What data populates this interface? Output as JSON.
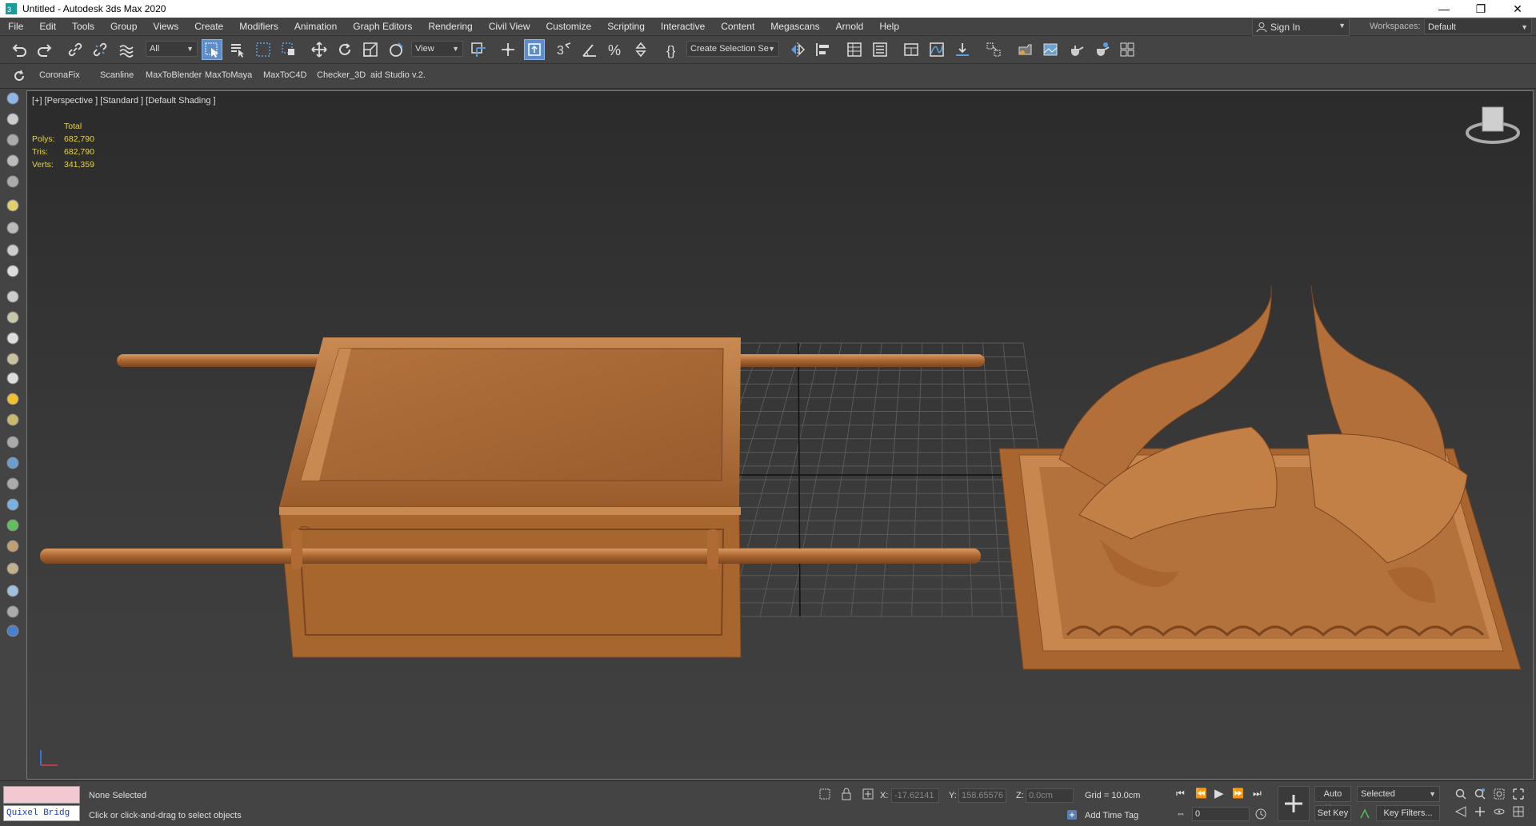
{
  "window": {
    "title": "Untitled - Autodesk 3ds Max 2020"
  },
  "menu": [
    "File",
    "Edit",
    "Tools",
    "Group",
    "Views",
    "Create",
    "Modifiers",
    "Animation",
    "Graph Editors",
    "Rendering",
    "Civil View",
    "Customize",
    "Scripting",
    "Interactive",
    "Content",
    "Megascans",
    "Arnold",
    "Help"
  ],
  "account": {
    "sign_in": "Sign In",
    "workspaces_label": "Workspaces:",
    "workspace": "Default"
  },
  "toolbar": {
    "filter": "All",
    "ref_coord": "View",
    "selection_set": "Create Selection Se"
  },
  "ribbon": [
    "CoronaFix",
    "Scanline",
    "MaxToBlender",
    "MaxToMaya",
    "MaxToC4D",
    "Checker_3D",
    "aid Studio v.2."
  ],
  "viewport": {
    "label": "[+] [Perspective ] [Standard ] [Default Shading ]",
    "stats": {
      "header": "Total",
      "rows": [
        {
          "k": "Polys:",
          "v": "682,790"
        },
        {
          "k": "Tris:",
          "v": "682,790"
        },
        {
          "k": "Verts:",
          "v": "341,359"
        }
      ]
    }
  },
  "status": {
    "quixel": "Quixel Bridg",
    "selection": "None Selected",
    "prompt": "Click or click-and-drag to select objects",
    "x_label": "X:",
    "x": "-17.62141",
    "y_label": "Y:",
    "y": "158.65576",
    "z_label": "Z:",
    "z": "0.0cm",
    "grid": "Grid = 10.0cm",
    "add_time_tag": "Add Time Tag",
    "auto_key": "Auto Key",
    "set_key": "Set Key",
    "key_mode": "Selected",
    "key_filters": "Key Filters...",
    "frame": "0"
  },
  "colors": {
    "accent": "#5e8ec9",
    "model": "#b8743f",
    "stats": "#e8d34c"
  }
}
